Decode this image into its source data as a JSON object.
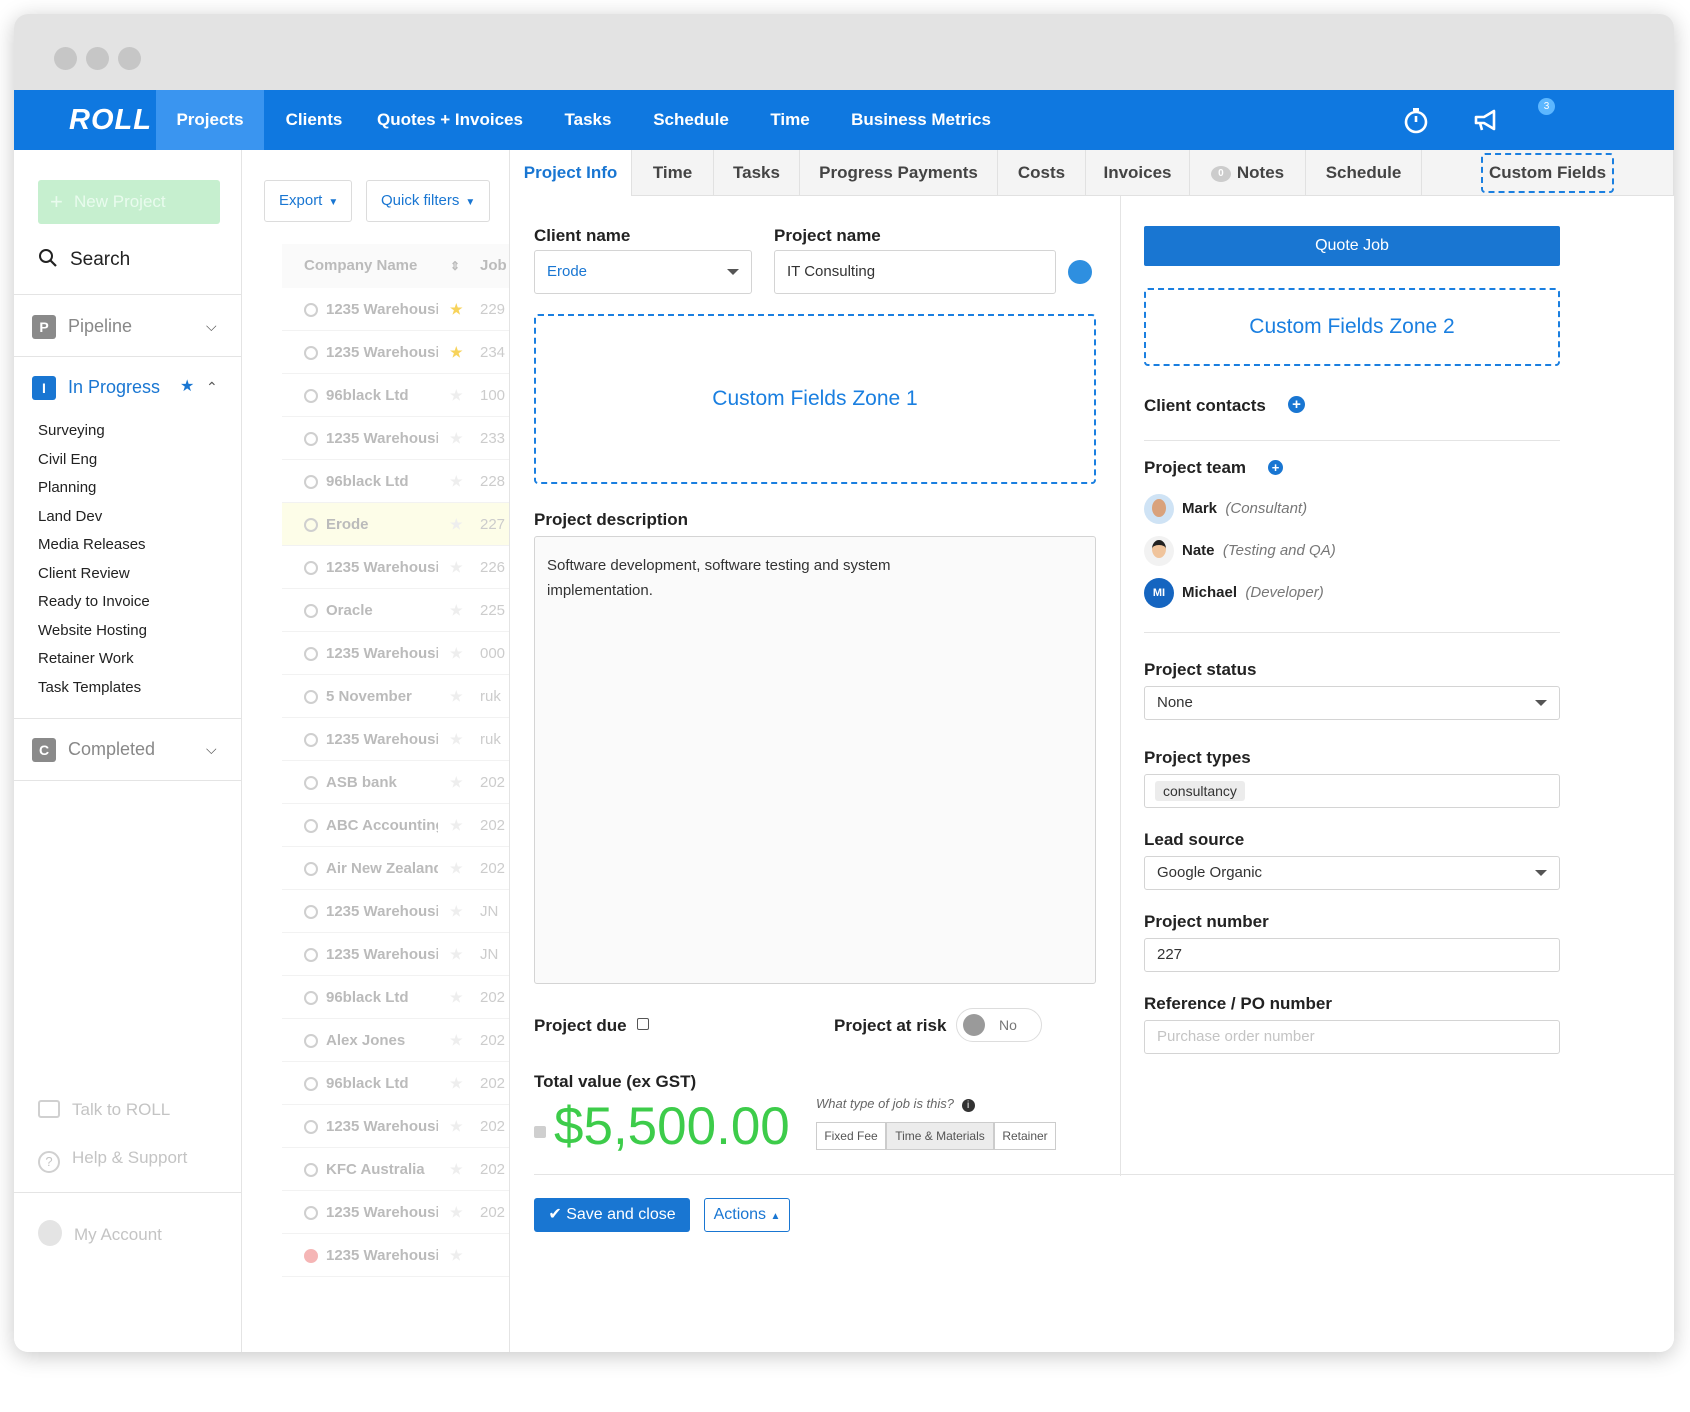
{
  "app": {
    "logo": "ROLL"
  },
  "nav": {
    "items": [
      "Projects",
      "Clients",
      "Quotes + Invoices",
      "Tasks",
      "Schedule",
      "Time",
      "Business Metrics"
    ],
    "timer_badge": "3"
  },
  "sidebar": {
    "new_project": "New Project",
    "search": "Search",
    "pipeline": {
      "letter": "P",
      "label": "Pipeline"
    },
    "in_progress": {
      "letter": "I",
      "label": "In Progress"
    },
    "subitems": [
      "Surveying",
      "Civil Eng",
      "Planning",
      "Land Dev",
      "Media Releases",
      "Client Review",
      "Ready to Invoice",
      "Website Hosting",
      "Retainer Work",
      "Task Templates"
    ],
    "completed": {
      "letter": "C",
      "label": "Completed"
    },
    "talk": "Talk to ROLL",
    "help": "Help & Support",
    "account": "My Account"
  },
  "list": {
    "export": "Export",
    "quick_filters": "Quick filters",
    "header_company": "Company Name",
    "header_job": "Job",
    "rows": [
      {
        "name": "1235 Warehousi",
        "num": "229",
        "star": true
      },
      {
        "name": "1235 Warehousi",
        "num": "234",
        "star": true
      },
      {
        "name": "96black Ltd",
        "num": "100",
        "star": false
      },
      {
        "name": "1235 Warehousi",
        "num": "233",
        "star": false
      },
      {
        "name": "96black Ltd",
        "num": "228",
        "star": false
      },
      {
        "name": "Erode",
        "num": "227",
        "star": false
      },
      {
        "name": "1235 Warehousi",
        "num": "226",
        "star": false
      },
      {
        "name": "Oracle",
        "num": "225",
        "star": false
      },
      {
        "name": "1235 Warehousi",
        "num": "000",
        "star": false
      },
      {
        "name": "5 November",
        "num": "ruk",
        "star": false
      },
      {
        "name": "1235 Warehousi",
        "num": "ruk",
        "star": false
      },
      {
        "name": "ASB bank",
        "num": "202",
        "star": false
      },
      {
        "name": "ABC Accounting",
        "num": "202",
        "star": false
      },
      {
        "name": "Air New Zealand",
        "num": "202",
        "star": false
      },
      {
        "name": "1235 Warehousi",
        "num": "JN",
        "star": false
      },
      {
        "name": "1235 Warehousi",
        "num": "JN",
        "star": false
      },
      {
        "name": "96black Ltd",
        "num": "202",
        "star": false
      },
      {
        "name": "Alex Jones",
        "num": "202",
        "star": false
      },
      {
        "name": "96black Ltd",
        "num": "202",
        "star": false
      },
      {
        "name": "1235 Warehousi",
        "num": "202",
        "star": false
      },
      {
        "name": "KFC Australia",
        "num": "202",
        "star": false
      },
      {
        "name": "1235 Warehousi",
        "num": "202",
        "star": false
      },
      {
        "name": "1235 Warehousi",
        "num": "",
        "star": false
      }
    ]
  },
  "tabs": [
    "Project Info",
    "Time",
    "Tasks",
    "Progress Payments",
    "Costs",
    "Invoices",
    "Notes",
    "Schedule",
    "Custom Fields"
  ],
  "notes_count": "0",
  "form": {
    "client_label": "Client name",
    "client_value": "Erode",
    "project_label": "Project name",
    "project_value": "IT Consulting",
    "zone1": "Custom Fields Zone 1",
    "desc_label": "Project description",
    "desc_value": "Software development, software testing and system implementation.",
    "due_label": "Project due",
    "risk_label": "Project at risk",
    "risk_value": "No",
    "total_label": "Total value (ex GST)",
    "total_value": "$5,500.00",
    "job_type_q": "What type of job is this?",
    "job_types": [
      "Fixed Fee",
      "Time & Materials",
      "Retainer"
    ],
    "job_type_selected": "Time & Materials",
    "save": "Save and close",
    "actions": "Actions"
  },
  "right": {
    "quote_job": "Quote Job",
    "zone2": "Custom Fields Zone 2",
    "contacts_label": "Client contacts",
    "team_label": "Project team",
    "team": [
      {
        "name": "Mark",
        "role": "(Consultant)"
      },
      {
        "name": "Nate",
        "role": "(Testing and QA)"
      },
      {
        "name": "Michael",
        "role": "(Developer)",
        "initials": "MI"
      }
    ],
    "status_label": "Project status",
    "status_value": "None",
    "types_label": "Project types",
    "types_value": "consultancy",
    "lead_label": "Lead source",
    "lead_value": "Google Organic",
    "number_label": "Project number",
    "number_value": "227",
    "ref_label": "Reference / PO number",
    "ref_placeholder": "Purchase order number"
  },
  "colors": {
    "brand": "#0f78e0",
    "accent": "#1a7fe0",
    "total": "#3dcc4a"
  }
}
